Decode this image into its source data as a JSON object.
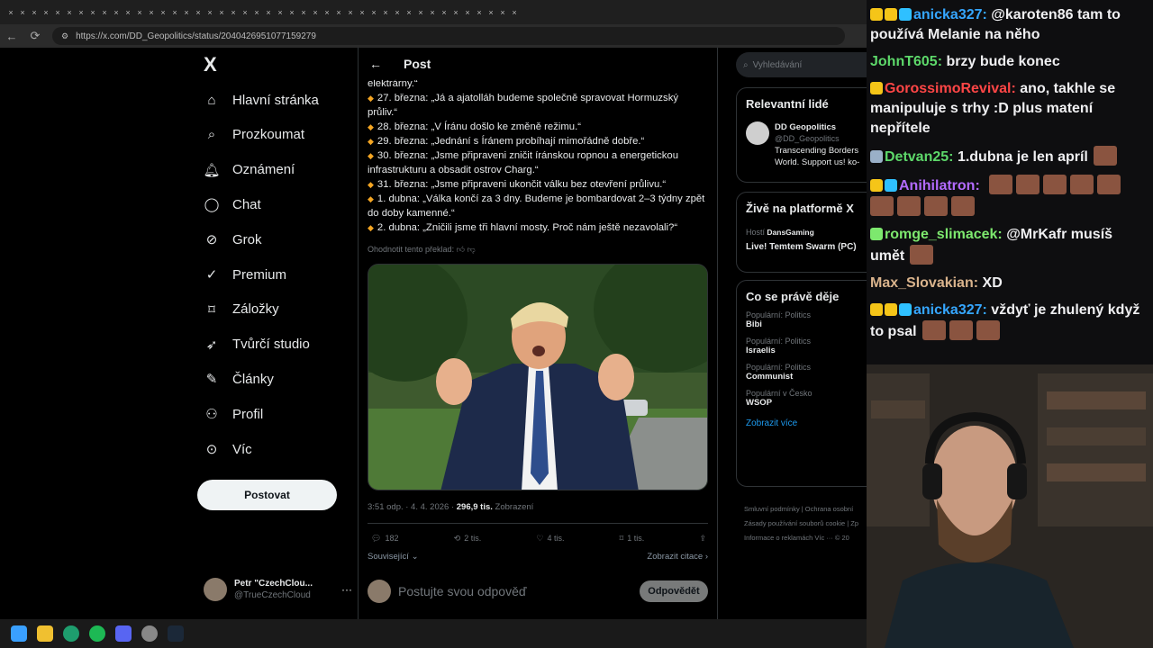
{
  "browser": {
    "url": "https://x.com/DD_Geopolitics/status/2040426951077159279"
  },
  "nav": {
    "logo": "X",
    "items": [
      {
        "label": "Hlavní stránka",
        "icon": "home-icon"
      },
      {
        "label": "Prozkoumat",
        "icon": "search-icon"
      },
      {
        "label": "Oznámení",
        "icon": "bell-icon"
      },
      {
        "label": "Chat",
        "icon": "chat-icon"
      },
      {
        "label": "Grok",
        "icon": "grok-icon"
      },
      {
        "label": "Premium",
        "icon": "premium-icon"
      },
      {
        "label": "Záložky",
        "icon": "bookmark-icon"
      },
      {
        "label": "Tvůrčí studio",
        "icon": "rocket-icon"
      },
      {
        "label": "Články",
        "icon": "article-icon"
      },
      {
        "label": "Profil",
        "icon": "user-icon"
      },
      {
        "label": "Víc",
        "icon": "more-icon"
      }
    ],
    "post_button": "Postovat",
    "account": {
      "name": "Petr \"CzechClou...",
      "handle": "@TrueCzechCloud"
    }
  },
  "post": {
    "header": "Post",
    "lines": [
      {
        "bullet": false,
        "text": "elektrárny.“"
      },
      {
        "bullet": true,
        "text": "27. března: „Já a ajatolláh budeme společně spravovat Hormuzský průliv.“"
      },
      {
        "bullet": true,
        "text": "28. března: „V Íránu došlo ke změně režimu.“"
      },
      {
        "bullet": true,
        "text": "29. března: „Jednání s Íránem probíhají mimořádně dobře.“"
      },
      {
        "bullet": true,
        "text": "30. března: „Jsme připraveni zničit íránskou ropnou a energetickou infrastrukturu a obsadit ostrov Charg.“"
      },
      {
        "bullet": true,
        "text": "31. března: „Jsme připraveni ukončit válku bez otevření průlivu.“"
      },
      {
        "bullet": true,
        "text": "1. dubna: „Válka končí za 3 dny. Budeme je bombardovat 2–3 týdny zpět do doby kamenné.“"
      },
      {
        "bullet": true,
        "text": "2. dubna: „Zničili jsme tři hlavní mosty. Proč nám ještě nezavolali?“"
      }
    ],
    "rate_translation": "Ohodnotit tento překlad:",
    "time": "3:51 odp. · 4. 4. 2026 · ",
    "views_count": "296,9 tis.",
    "views_label": " Zobrazení",
    "actions": {
      "replies": "182",
      "reposts": "2 tis.",
      "likes": "4 tis.",
      "bookmarks": "1 tis."
    },
    "related": "Související",
    "quotes": "Zobrazit citace",
    "reply_placeholder": "Postujte svou odpověď",
    "reply_button": "Odpovědět"
  },
  "sidebar": {
    "search_placeholder": "Vyhledávání",
    "relevant_title": "Relevantní lidé",
    "person": {
      "name": "DD Geopolitics",
      "handle": "@DD_Geopolitics",
      "bio": "Transcending Borders World. Support us! ko-"
    },
    "live_title": "Živě na platformě X",
    "live_host_label": "Hostí",
    "live_host": "DansGaming",
    "live_stream": "Live! Temtem Swarm (PC)",
    "trending_title": "Co se právě děje",
    "trends": [
      {
        "category": "Populární: Politics",
        "name": "Bibi"
      },
      {
        "category": "Populární: Politics",
        "name": "Israelis"
      },
      {
        "category": "Populární: Politics",
        "name": "Communist"
      },
      {
        "category": "Populární v Česko",
        "name": "WSOP"
      }
    ],
    "show_more": "Zobrazit více",
    "footer": [
      "Smluvní podmínky  |  Ochrana osobní",
      "Zásady používání souborů cookie  |  Zp",
      "Informace o reklamách   Víc ···  © 20"
    ]
  },
  "chat": {
    "messages": [
      {
        "user": "anicka327",
        "color": "#35a6ff",
        "badges": [
          "#f5c518",
          "#f5c518",
          "#2fc0ff"
        ],
        "text": "@karoten86 tam to používá Melanie na něho",
        "emotes": 0
      },
      {
        "user": "JohnT605",
        "color": "#5dd86a",
        "badges": [],
        "text": "brzy bude konec",
        "emotes": 0
      },
      {
        "user": "GorossimoRevival",
        "color": "#ff4646",
        "badges": [
          "#f5c518"
        ],
        "text": "ano, takhle se manipuluje s trhy :D plus matení nepřítele",
        "emotes": 0
      },
      {
        "user": "Detvan25",
        "color": "#5dd86a",
        "badges": [
          "#9ab0c8"
        ],
        "text": "1.dubna je len apríl",
        "emotes": 1
      },
      {
        "user": "Anihilatron",
        "color": "#b36bff",
        "badges": [
          "#f5c518",
          "#2fc0ff"
        ],
        "text": "",
        "emotes": 9
      },
      {
        "user": "romge_slimacek",
        "color": "#7de86e",
        "badges": [
          "#7de86e"
        ],
        "text": "@MrKafr musíš umět",
        "emotes": 1
      },
      {
        "user": "Max_Slovakian",
        "color": "#d9b38c",
        "badges": [],
        "text": "XD",
        "emotes": 0
      },
      {
        "user": "anicka327",
        "color": "#35a6ff",
        "badges": [
          "#f5c518",
          "#f5c518",
          "#2fc0ff"
        ],
        "text": "vždyť je zhulený když to psal",
        "emotes": 3
      }
    ]
  }
}
